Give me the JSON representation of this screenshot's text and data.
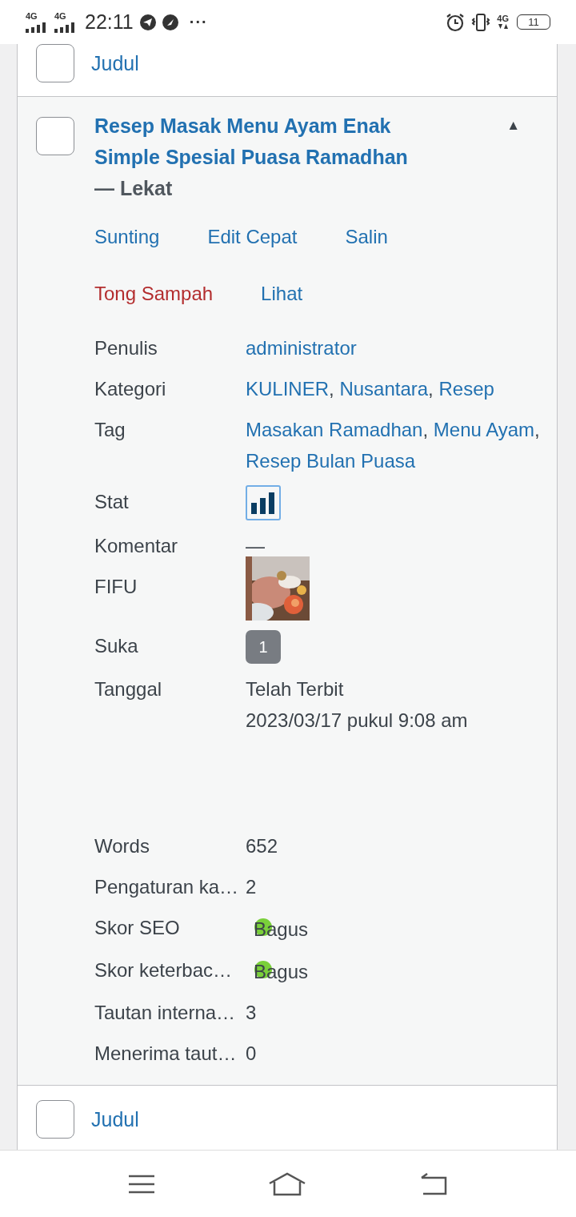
{
  "status_bar": {
    "signals": [
      "4G",
      "4G"
    ],
    "time": "22:11",
    "more": "···",
    "network": "4G",
    "battery": "11"
  },
  "rows": [
    {
      "kind": "header",
      "label": "Judul",
      "checked": false
    },
    {
      "kind": "post",
      "checked": false,
      "expanded": true,
      "toggle": "▲",
      "title": "Resep Masak Menu Ayam Enak Simple Spesial Puasa Ramadhan",
      "post_state": "— Lekat",
      "actions": [
        {
          "label": "Sunting",
          "kind": "link"
        },
        {
          "label": "Edit Cepat",
          "kind": "link"
        },
        {
          "label": "Salin",
          "kind": "link"
        },
        {
          "label": "Tong Sampah",
          "kind": "danger"
        },
        {
          "label": "Lihat",
          "kind": "link"
        }
      ],
      "fields": [
        {
          "kind": "links",
          "label": "Penulis",
          "links": [
            "administrator"
          ]
        },
        {
          "kind": "links",
          "label": "Kategori",
          "links": [
            "KULINER",
            "Nusantara",
            "Resep"
          ],
          "separator": ","
        },
        {
          "kind": "links",
          "label": "Tag",
          "links": [
            "Masakan Ramadhan",
            "Menu Ayam",
            "Resep Bulan Puasa"
          ],
          "separator": ","
        },
        {
          "kind": "stat",
          "label": "Stat"
        },
        {
          "kind": "text",
          "label": "Komentar",
          "lines": [
            "—"
          ]
        },
        {
          "kind": "picture",
          "label": "FIFU"
        },
        {
          "kind": "count",
          "label": "Suka",
          "value": "1"
        },
        {
          "kind": "date",
          "label": "Tanggal",
          "lines": [
            "Telah Terbit",
            "2023/03/17 pukul 9:08 am"
          ]
        },
        {
          "kind": "text",
          "label": "Words",
          "lines": [
            "652"
          ]
        },
        {
          "kind": "text",
          "label": "Pengaturan ka…",
          "lines": [
            "2"
          ]
        },
        {
          "kind": "score",
          "label": "Skor SEO",
          "value": "Bagus",
          "color": "#7ad03a"
        },
        {
          "kind": "score",
          "label": "Skor keterbac…",
          "value": "Bagus",
          "color": "#7ad03a"
        },
        {
          "kind": "text",
          "label": "Tautan interna…",
          "lines": [
            "3"
          ]
        },
        {
          "kind": "text",
          "label": "Menerima taut…",
          "lines": [
            "0"
          ]
        }
      ]
    },
    {
      "kind": "header",
      "label": "Judul",
      "checked": false
    }
  ]
}
